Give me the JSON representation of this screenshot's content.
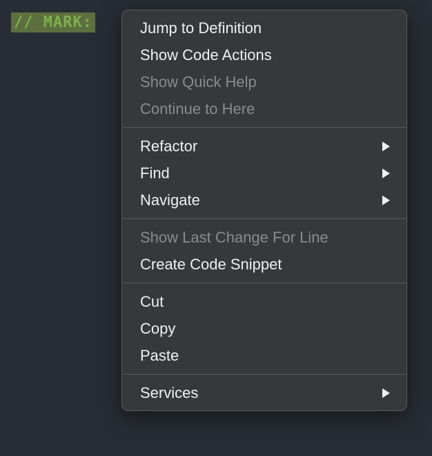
{
  "code": {
    "comment_text": "// MARK:"
  },
  "menu": {
    "groups": [
      [
        {
          "label": "Jump to Definition",
          "enabled": true,
          "submenu": false
        },
        {
          "label": "Show Code Actions",
          "enabled": true,
          "submenu": false
        },
        {
          "label": "Show Quick Help",
          "enabled": false,
          "submenu": false
        },
        {
          "label": "Continue to Here",
          "enabled": false,
          "submenu": false
        }
      ],
      [
        {
          "label": "Refactor",
          "enabled": true,
          "submenu": true
        },
        {
          "label": "Find",
          "enabled": true,
          "submenu": true
        },
        {
          "label": "Navigate",
          "enabled": true,
          "submenu": true
        }
      ],
      [
        {
          "label": "Show Last Change For Line",
          "enabled": false,
          "submenu": false
        },
        {
          "label": "Create Code Snippet",
          "enabled": true,
          "submenu": false
        }
      ],
      [
        {
          "label": "Cut",
          "enabled": true,
          "submenu": false
        },
        {
          "label": "Copy",
          "enabled": true,
          "submenu": false
        },
        {
          "label": "Paste",
          "enabled": true,
          "submenu": false
        }
      ],
      [
        {
          "label": "Services",
          "enabled": true,
          "submenu": true
        }
      ]
    ]
  }
}
